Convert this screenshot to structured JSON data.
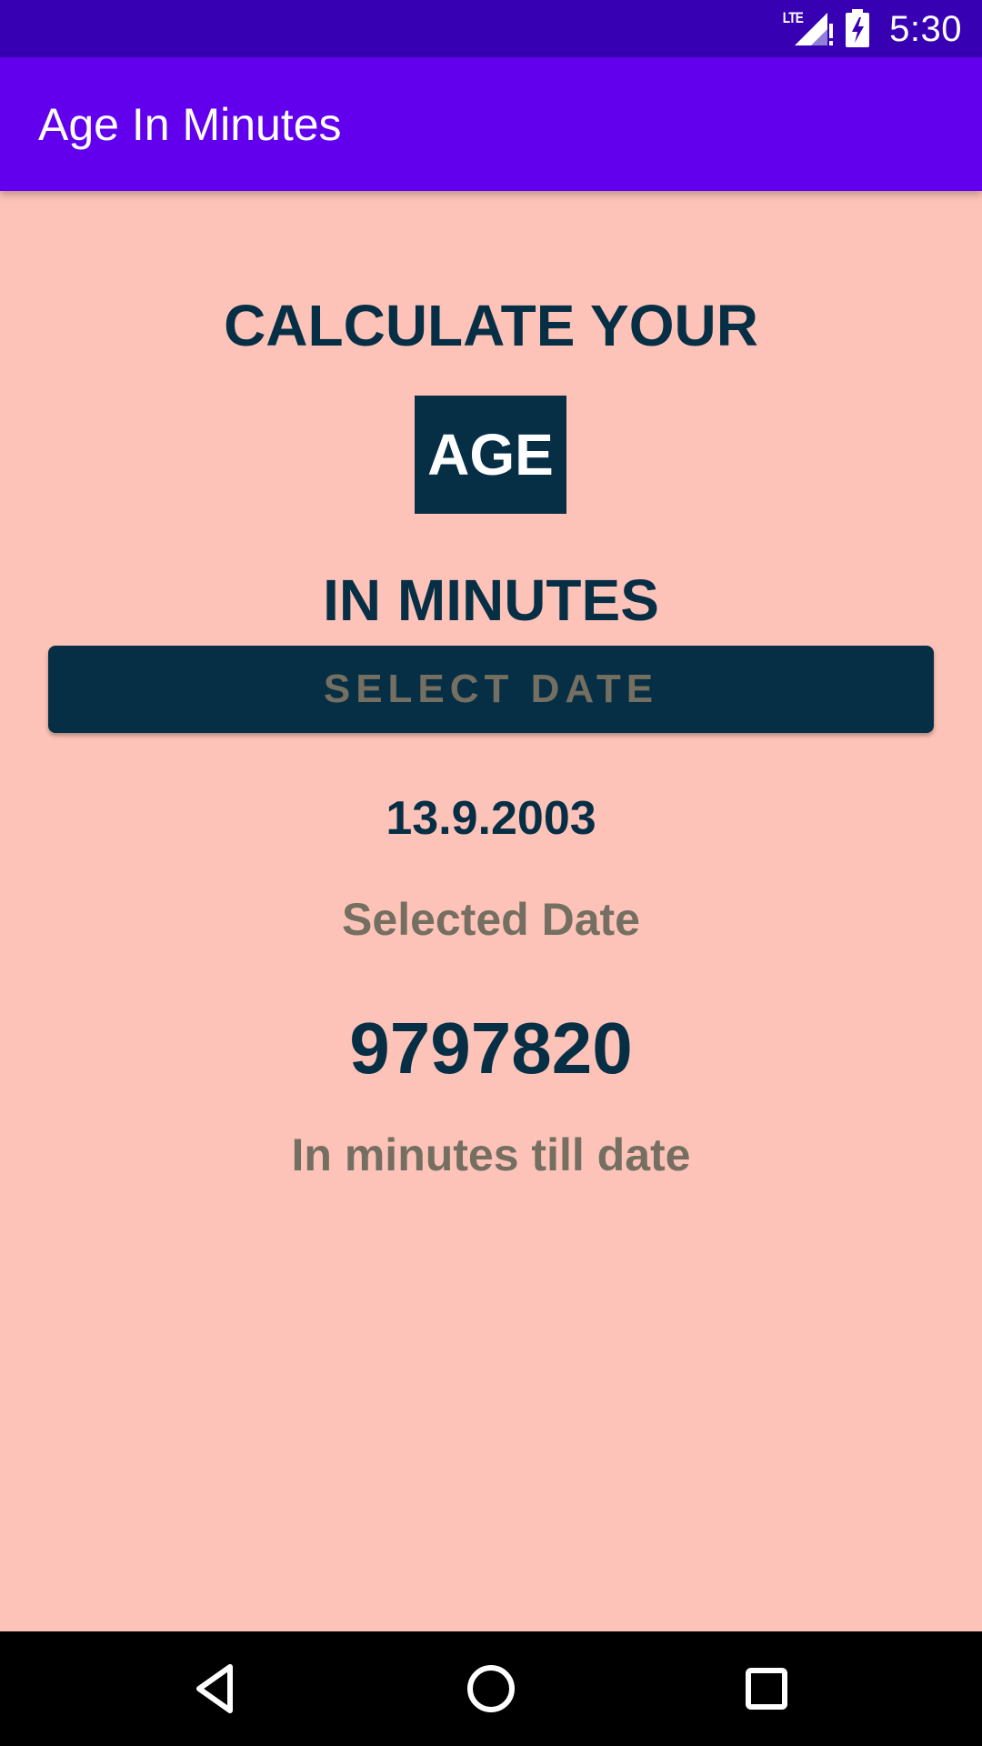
{
  "status_bar": {
    "time": "5:30",
    "network": "LTE",
    "icons": [
      "lte-signal-icon",
      "battery-charging-icon"
    ]
  },
  "app_bar": {
    "title": "Age In Minutes"
  },
  "main": {
    "heading_line1": "CALCULATE YOUR",
    "heading_highlight": "AGE",
    "heading_line3": "IN MINUTES",
    "select_button_label": "SELECT DATE",
    "selected_date_value": "13.9.2003",
    "selected_date_label": "Selected Date",
    "minutes_value": "9797820",
    "minutes_label": "In minutes till date"
  },
  "nav_bar": {
    "icons": [
      "back-icon",
      "home-icon",
      "recents-icon"
    ]
  },
  "colors": {
    "status_bar": "#3700B3",
    "app_bar": "#6200EE",
    "background": "#FEC3B8",
    "primary_text": "#062F45",
    "secondary_text": "#746F60"
  }
}
